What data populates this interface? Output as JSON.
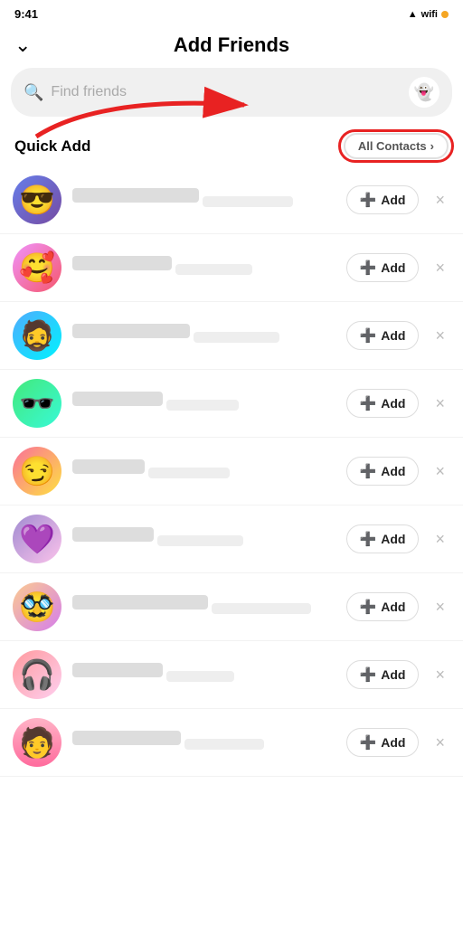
{
  "statusBar": {
    "time": "9:41",
    "batteryColor": "#f5a623"
  },
  "header": {
    "backLabel": "chevron down",
    "title": "Add Friends"
  },
  "search": {
    "placeholder": "Find friends",
    "ghostIconLabel": "ghost"
  },
  "quickAdd": {
    "title": "Quick Add",
    "allContactsLabel": "All Contacts",
    "allContactsChevron": "›"
  },
  "friends": [
    {
      "id": 1,
      "nameWidth": 140,
      "subWidth": 100,
      "addLabel": "Add",
      "avatarClass": "av1",
      "emoji": "😎"
    },
    {
      "id": 2,
      "nameWidth": 110,
      "subWidth": 85,
      "addLabel": "Add",
      "avatarClass": "av2",
      "emoji": "🥰"
    },
    {
      "id": 3,
      "nameWidth": 130,
      "subWidth": 95,
      "addLabel": "Add",
      "avatarClass": "av3",
      "emoji": "🧔"
    },
    {
      "id": 4,
      "nameWidth": 100,
      "subWidth": 80,
      "addLabel": "Add",
      "avatarClass": "av4",
      "emoji": "🕶️"
    },
    {
      "id": 5,
      "nameWidth": 80,
      "subWidth": 90,
      "addLabel": "Add",
      "avatarClass": "av5",
      "emoji": "😏"
    },
    {
      "id": 6,
      "nameWidth": 90,
      "subWidth": 95,
      "addLabel": "Add",
      "avatarClass": "av6",
      "emoji": "💜"
    },
    {
      "id": 7,
      "nameWidth": 150,
      "subWidth": 110,
      "addLabel": "Add",
      "avatarClass": "av7",
      "emoji": "🥸"
    },
    {
      "id": 8,
      "nameWidth": 100,
      "subWidth": 75,
      "addLabel": "Add",
      "avatarClass": "av8",
      "emoji": "🎧"
    },
    {
      "id": 9,
      "nameWidth": 120,
      "subWidth": 88,
      "addLabel": "Add",
      "avatarClass": "av9",
      "emoji": "🧑"
    }
  ],
  "arrow": {
    "label": "red arrow pointing to All Contacts"
  }
}
